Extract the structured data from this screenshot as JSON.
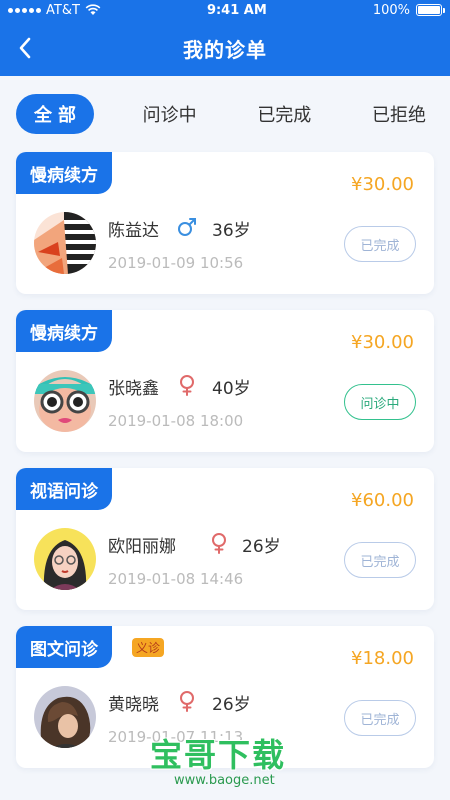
{
  "status_bar": {
    "carrier": "AT&T",
    "time": "9:41 AM",
    "battery": "100%",
    "battery_level": 1.0
  },
  "nav": {
    "title": "我的诊单",
    "back_icon": "chevron-left-icon"
  },
  "tabs": [
    {
      "label": "全部",
      "active": true
    },
    {
      "label": "问诊中",
      "active": false
    },
    {
      "label": "已完成",
      "active": false
    },
    {
      "label": "已拒绝",
      "active": false
    }
  ],
  "orders": [
    {
      "tag": "慢病续方",
      "price": "¥30.00",
      "name": "陈益达",
      "gender": "male",
      "age": "36岁",
      "date": "2019-01-09 10:56",
      "status": "已完成"
    },
    {
      "tag": "慢病续方",
      "price": "¥30.00",
      "name": "张晓鑫",
      "gender": "female",
      "age": "40岁",
      "date": "2019-01-08 18:00",
      "status": "问诊中"
    },
    {
      "tag": "视语问诊",
      "price": "¥60.00",
      "name": "欧阳丽娜",
      "gender": "female",
      "age": "26岁",
      "date": "2019-01-08 14:46",
      "status": "已完成"
    },
    {
      "tag": "图文问诊",
      "badge": "义诊",
      "price": "¥18.00",
      "name": "黄晓晓",
      "gender": "female",
      "age": "26岁",
      "date": "2019-01-07 11:13",
      "status": "已完成"
    }
  ],
  "watermark": {
    "title": "宝哥下载",
    "url": "www.baoge.net"
  },
  "colors": {
    "primary": "#1a73e8",
    "price": "#f5a623",
    "male": "#3a8fe0",
    "female": "#e06a6a",
    "ongoing": "#33c18e"
  }
}
